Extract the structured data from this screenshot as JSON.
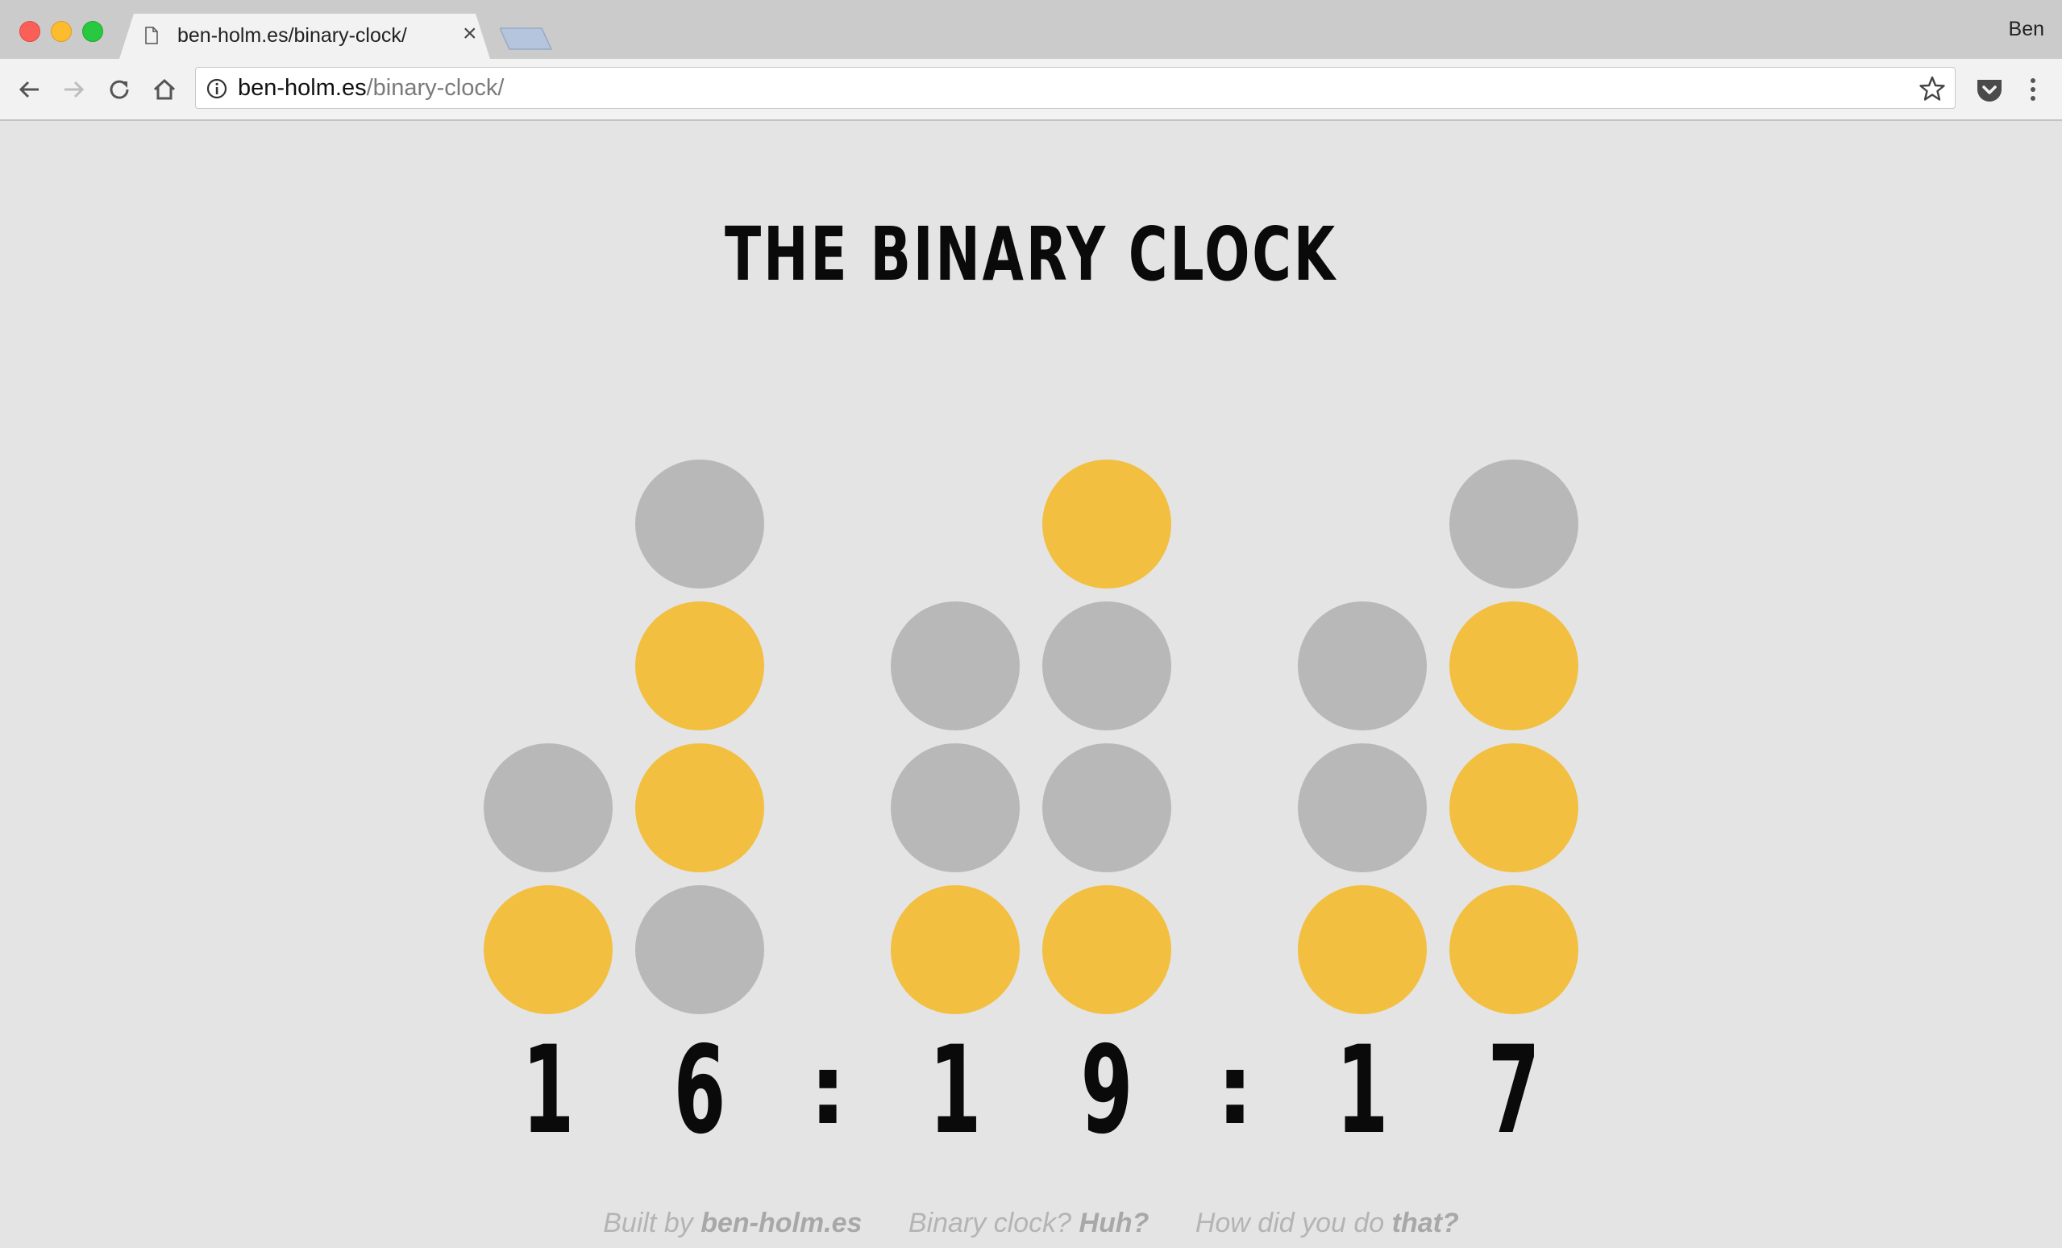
{
  "browser": {
    "tab_title": "ben-holm.es/binary-clock/",
    "tab_close": "×",
    "profile": "Ben",
    "url_host": "ben-holm.es",
    "url_path": "/binary-clock/",
    "icons": [
      "back-icon",
      "forward-icon",
      "reload-icon",
      "home-icon",
      "info-icon",
      "star-icon",
      "pocket-icon",
      "menu-icon"
    ]
  },
  "page": {
    "title": "THE BINARY CLOCK",
    "colors": {
      "on": "#f2bf40",
      "off": "#b8b8b8",
      "background": "#e4e4e4"
    },
    "time_digits": [
      "1",
      "6",
      ":",
      "1",
      "9",
      ":",
      "1",
      "7"
    ],
    "columns": [
      {
        "digit": "1",
        "bits_top_to_bottom": [
          0,
          1
        ]
      },
      {
        "digit": "6",
        "bits_top_to_bottom": [
          0,
          1,
          1,
          0
        ]
      },
      {
        "digit": "1",
        "bits_top_to_bottom": [
          0,
          0,
          1
        ]
      },
      {
        "digit": "9",
        "bits_top_to_bottom": [
          1,
          0,
          0,
          1
        ]
      },
      {
        "digit": "1",
        "bits_top_to_bottom": [
          0,
          0,
          1
        ]
      },
      {
        "digit": "7",
        "bits_top_to_bottom": [
          0,
          1,
          1,
          1
        ]
      }
    ]
  },
  "footer": {
    "built_prefix": "Built by ",
    "built_link": "ben-holm.es",
    "q1_prefix": "Binary clock? ",
    "q1_link": "Huh?",
    "q2_prefix": "How did you do ",
    "q2_link": "that?"
  }
}
